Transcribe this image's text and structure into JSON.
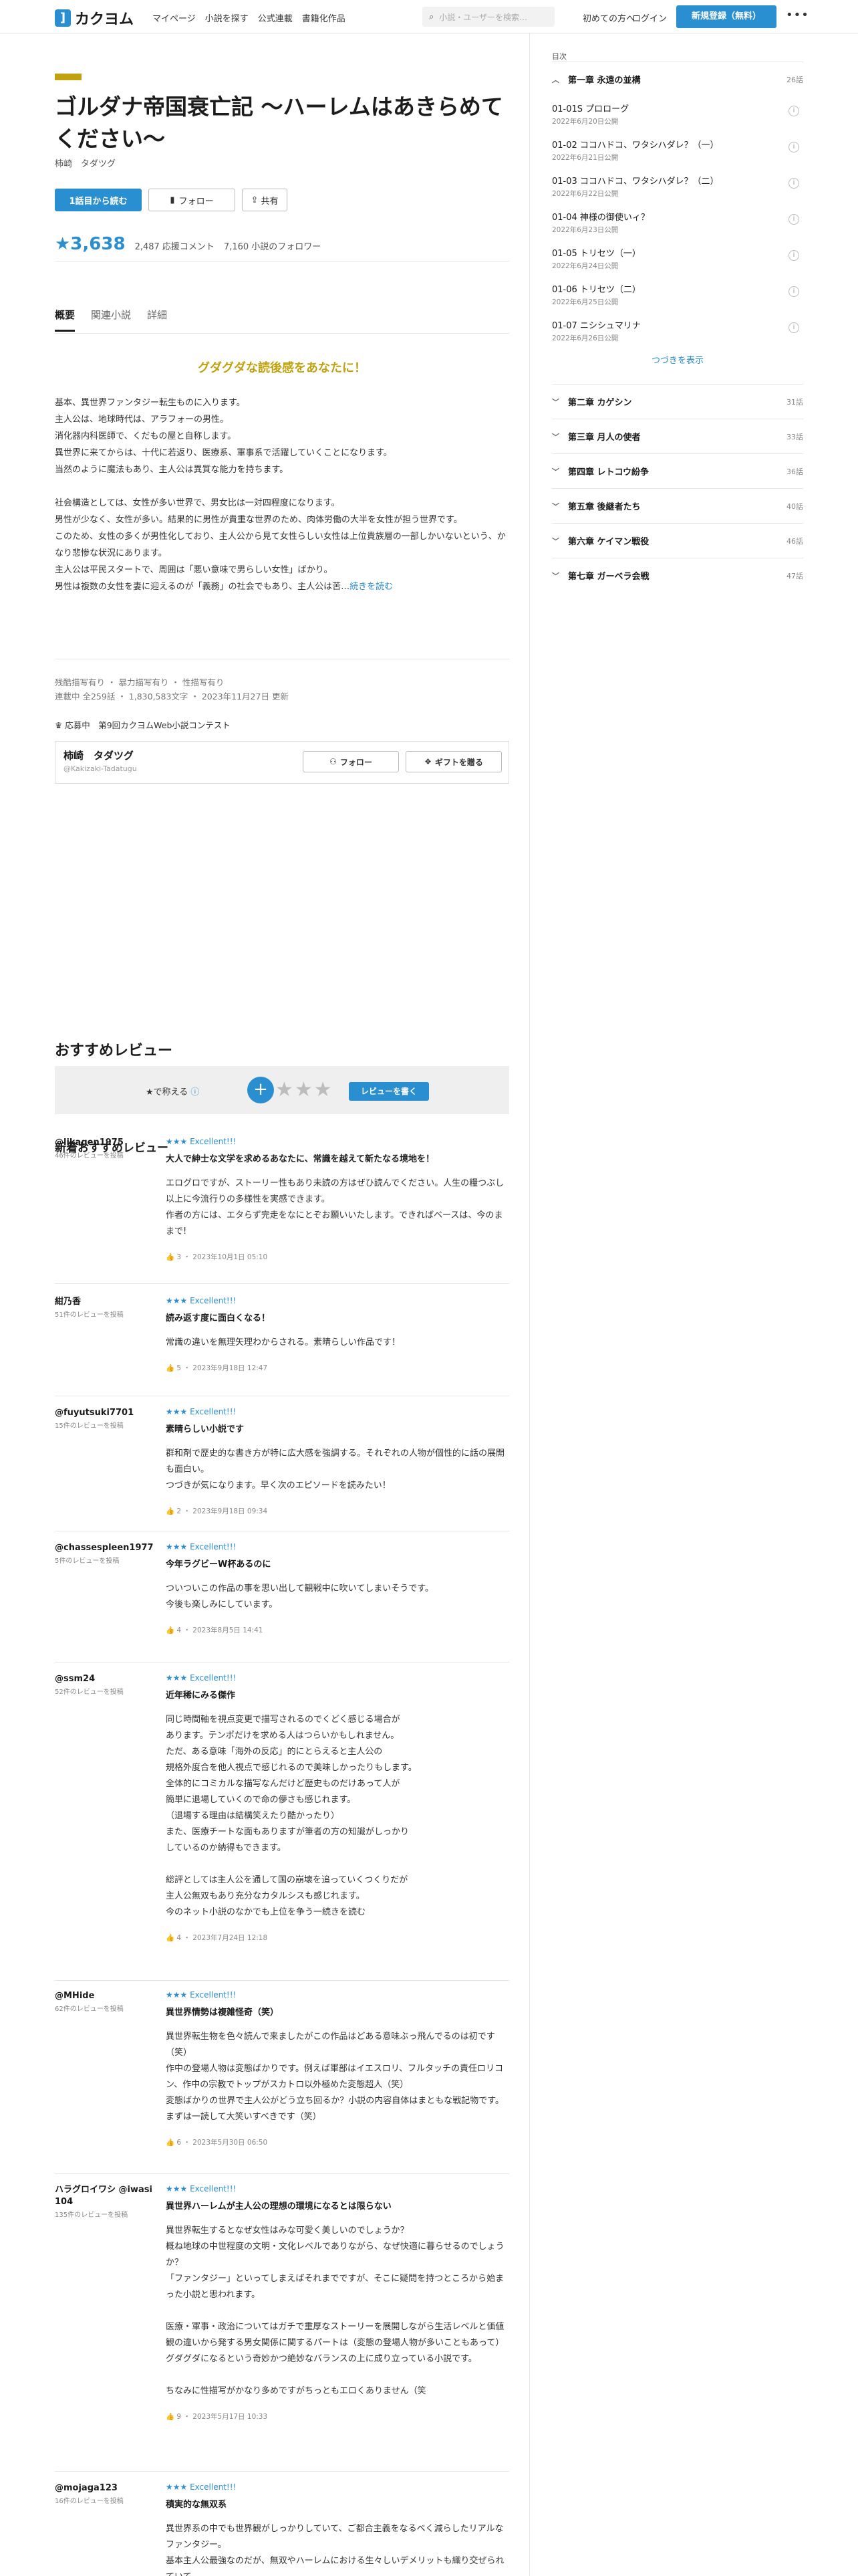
{
  "header": {
    "logo_mark": "]",
    "logo_text": "カクヨム",
    "nav": [
      "マイページ",
      "小説を探す",
      "公式連載",
      "書籍化作品"
    ],
    "search_placeholder": "小説・ユーザーを検索…",
    "first_time": "初めての方へ",
    "login": "ログイン",
    "signup": "新規登録（無料）",
    "more": "•••"
  },
  "work": {
    "title": "ゴルダナ帝国衰亡記 〜ハーレムはあきらめてください〜",
    "author": "柿崎　タダツグ",
    "buttons": {
      "read_first": "1話目から読む",
      "follow": "フォロー",
      "share": "共有"
    },
    "stars": "★3,638",
    "review_comments": "2,487 応援コメント",
    "followers": "7,160 小説のフォロワー",
    "tabs": [
      "概要",
      "関連小説",
      "詳細"
    ],
    "catchphrase": "グダグダな読後感をあなたに！",
    "intro": [
      "基本、異世界ファンタジー転生ものに入ります。",
      "主人公は、地球時代は、アラフォーの男性。",
      "消化器内科医師で、くだもの屋と自称します。",
      "異世界に来てからは、十代に若返り、医療系、軍事系で活躍していくことになります。",
      "当然のように魔法もあり、主人公は異質な能力を持ちます。",
      "",
      "社会構造としては、女性が多い世界で、男女比は一対四程度になります。",
      "男性が少なく、女性が多い。結果的に男性が貴重な世界のため、肉体労働の大半を女性が担う世界です。",
      "このため、女性の多くが男性化しており、主人公から見て女性らしい女性は上位貴族層の一部しかいないという、かなり悲惨な状況にあります。",
      "主人公は平民スタートで、周囲は「悪い意味で男らしい女性」ばかり。",
      "男性は複数の女性を妻に迎えるのが「義務」の社会でもあり、主人公は苦…"
    ],
    "read_more": "続きを読む",
    "tags": "残酷描写有り ・ 暴力描写有り ・ 性描写有り",
    "status": "連載中 全259話 ・ 1,830,583文字 ・ 2023年11月27日 更新",
    "contest": "応募中　第9回カクヨムWeb小説コンテスト",
    "author_box": {
      "name": "柿崎　タダツグ",
      "id": "@Kakizaki-Tadatugu",
      "follow": "フォロー",
      "gift": "ギフトを贈る"
    }
  },
  "reviews": {
    "section_title": "おすすめレビュー",
    "rate_label": "★で称える",
    "rate_plus": "+",
    "rate_stars": "★★★",
    "write_button": "レビューを書く",
    "new_title": "新着おすすめレビュー",
    "items": [
      {
        "user": "@likagen1975",
        "count": "46件のレビューを投稿",
        "stars": "★★★ Excellent!!!",
        "title": "大人で紳士な文学を求めるあなたに、常識を越えて新たなる境地を！",
        "text": [
          "エログロですが、ストーリー性もあり未読の方はぜひ読んでください。人生の糧つぶし以上に今流行りの多様性を実感できます。",
          "作者の方には、エタらず完走をなにとぞお願いいたします。できればベースは、今のままで!"
        ],
        "likes": "3",
        "date": "2023年10月1日 05:10"
      },
      {
        "user": "紺乃香",
        "count": "51件のレビューを投稿",
        "stars": "★★★ Excellent!!!",
        "title": "読み返す度に面白くなる！",
        "text": [
          "常識の違いを無理矢理わからされる。素晴らしい作品です！"
        ],
        "likes": "5",
        "date": "2023年9月18日 12:47"
      },
      {
        "user": "@fuyutsuki7701",
        "count": "15件のレビューを投稿",
        "stars": "★★★ Excellent!!!",
        "title": "素晴らしい小説です",
        "text": [
          "群和剤で歴史的な書き方が特に広大感を強調する。それぞれの人物が個性的に話の展開も面白い。",
          "つづきが気になります。早く次のエピソードを読みたい！"
        ],
        "likes": "2",
        "date": "2023年9月18日 09:34"
      },
      {
        "user": "@chassespleen1977",
        "count": "5件のレビューを投稿",
        "stars": "★★★ Excellent!!!",
        "title": "今年ラグビーW杯あるのに",
        "text": [
          "ついついこの作品の事を思い出して観戦中に吹いてしまいそうです。",
          "今後も楽しみにしています。"
        ],
        "likes": "4",
        "date": "2023年8月5日 14:41"
      },
      {
        "user": "@ssm24",
        "count": "52件のレビューを投稿",
        "stars": "★★★ Excellent!!!",
        "title": "近年稀にみる傑作",
        "text": [
          "同じ時間軸を視点変更で描写されるのでくどく感じる場合が",
          "あります。テンポだけを求める人はつらいかもしれません。",
          "ただ、ある意味「海外の反応」的にとらえると主人公の",
          "規格外度合を他人視点で感じれるので美味しかったりもします。",
          "全体的にコミカルな描写なんだけど歴史ものだけあって人が",
          "簡単に退場していくので命の儚さも感じれます。",
          "（退場する理由は結構笑えたり酷かったり）",
          "また、医療チートな面もありますが筆者の方の知識がしっかり",
          "しているのか納得もできます。",
          "",
          "総評としては主人公を通して国の崩壊を追っていくつくりだが",
          "主人公無双もあり充分なカタルシスも感じれます。",
          "今のネット小説のなかでも上位を争う一続きを読む"
        ],
        "likes": "4",
        "date": "2023年7月24日 12:18"
      },
      {
        "user": "@MHide",
        "count": "62件のレビューを投稿",
        "stars": "★★★ Excellent!!!",
        "title": "異世界情勢は複雑怪奇（笑）",
        "text": [
          "異世界転生物を色々読んで来ましたがこの作品はどある意味ぶっ飛んでるのは初です（笑）",
          "作中の登場人物は変態ばかりです。例えば軍部はイエスロリ、フルタッチの責任ロリコン、作中の宗教でトップがスカトロ以外極めた変態超人（笑）",
          "変態ばかりの世界で主人公がどう立ち回るか？小説の内容自体はまともな戦記物です。まずは一読して大笑いすべきです（笑）"
        ],
        "likes": "6",
        "date": "2023年5月30日 06:50"
      },
      {
        "user": "ハラグロイワシ @iwasi104",
        "count": "135件のレビューを投稿",
        "stars": "★★★ Excellent!!!",
        "title": "異世界ハーレムが主人公の理想の環境になるとは限らない",
        "text": [
          "異世界転生するとなぜ女性はみな可愛く美しいのでしょうか？",
          "概ね地球の中世程度の文明・文化レベルでありながら、なぜ快適に暮らせるのでしょうか？",
          "「ファンタジー」といってしまえばそれまでですが、そこに疑問を持つところから始まった小説と思われます。",
          "",
          "医療・軍事・政治についてはガチで重厚なストーリーを展開しながら生活レベルと価値観の違いから発する男女関係に関するパートは（変態の登場人物が多いこともあって）グダグダになるという奇妙かつ絶妙なバランスの上に成り立っている小説です。",
          "",
          "ちなみに性描写がかなり多めですがちっともエロくありません（笑"
        ],
        "likes": "9",
        "date": "2023年5月17日 10:33"
      },
      {
        "user": "@mojaga123",
        "count": "16件のレビューを投稿",
        "stars": "★★★ Excellent!!!",
        "title": "積実的な無双系",
        "text": [
          "異世界系の中でも世界観がしっかりしていて、ご都合主義をなるべく減らしたリアルなファンタジー。",
          "基本主人公最強なのだが、無双やハーレムにおける生々しいデメリットも織り交ぜられていて"
        ],
        "likes": "",
        "date": ""
      }
    ]
  },
  "toc": {
    "head": "目次",
    "chapters": [
      {
        "title": "第一章 永遠の並構",
        "count": "26話",
        "open": true
      },
      {
        "title": "第二章 カゲシン",
        "count": "31話"
      },
      {
        "title": "第三章 月人の使者",
        "count": "33話"
      },
      {
        "title": "第四章 レトコウ紛争",
        "count": "36話"
      },
      {
        "title": "第五章 後継者たち",
        "count": "40話"
      },
      {
        "title": "第六章 ケイマン戦役",
        "count": "46話"
      },
      {
        "title": "第七章 ガーベラ会戦",
        "count": "47話"
      }
    ],
    "episodes": [
      {
        "title": "01-01S プロローグ",
        "date": "2022年6月20日公開"
      },
      {
        "title": "01-02 ココハドコ、ワタシハダレ？（一）",
        "date": "2022年6月21日公開"
      },
      {
        "title": "01-03 ココハドコ、ワタシハダレ？（二）",
        "date": "2022年6月22日公開"
      },
      {
        "title": "01-04 神様の御使いィ？",
        "date": "2022年6月23日公開"
      },
      {
        "title": "01-05 トリセツ（一）",
        "date": "2022年6月24日公開"
      },
      {
        "title": "01-06 トリセツ（二）",
        "date": "2022年6月25日公開"
      },
      {
        "title": "01-07 ニシシュマリナ",
        "date": "2022年6月26日公開"
      }
    ],
    "more": "つづきを表示"
  },
  "colors": {
    "accent": "#2a8fd0",
    "gold": "#c0a10f",
    "border": "#e6e6e6"
  },
  "icons": [
    "search-icon",
    "bookmark-icon",
    "share-icon",
    "trophy-icon",
    "person-plus-icon",
    "gift-icon",
    "help-icon",
    "thumb-icon",
    "chevron-down-icon",
    "chevron-up-icon",
    "info-icon"
  ]
}
